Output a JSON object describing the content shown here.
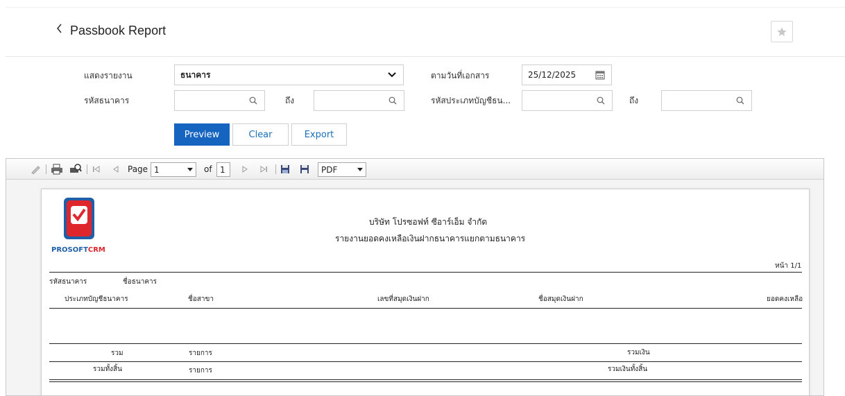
{
  "header": {
    "title": "Passbook Report",
    "back_icon": "chevron-left-icon",
    "favorite_icon": "star-icon"
  },
  "form": {
    "report_by_label": "แสดงรายงาน",
    "report_by_value": "ธนาคาร",
    "doc_date_label": "ตามวันที่เอกสาร",
    "doc_date_value": "25/12/2025",
    "bank_code_label": "รหัสธนาคาร",
    "bank_code_from": "",
    "to_label": "ถึง",
    "bank_code_to": "",
    "account_type_label": "รหัสประเภทบัญชีธน...",
    "account_type_from": "",
    "account_type_to": ""
  },
  "buttons": {
    "preview": "Preview",
    "clear": "Clear",
    "export": "Export"
  },
  "toolbar": {
    "page_label": "Page",
    "page_value": "1",
    "of_label": "of",
    "total_pages": "1",
    "format_value": "PDF"
  },
  "report": {
    "logo_text_1": "PROSOFT",
    "logo_text_2": "CRM",
    "company_name": "บริษัท โปรซอฟท์ ซีอาร์เอ็ม จำกัด",
    "report_title": "รายงานยอดคงเหลือเงินฝากธนาคารแยกตามธนาคาร",
    "page_indicator": "หน้า 1/1",
    "col_bank_code": "รหัสธนาคาร",
    "col_bank_name": "ชื่อธนาคาร",
    "col_account_type": "ประเภทบัญชีธนาคาร",
    "col_branch": "ชื่อสาขา",
    "col_passbook_no": "เลขที่สมุดเงินฝาก",
    "col_passbook_name": "ชื่อสมุดเงินฝาก",
    "col_balance": "ยอดคงเหลือ",
    "total_label": "รวม",
    "items_label": "รายการ",
    "total_amount_label": "รวมเงิน",
    "grand_total_label": "รวมทั้งสิ้น",
    "grand_items_label": "รายการ",
    "grand_amount_label": "รวมเงินทั้งสิ้น"
  },
  "colors": {
    "primary": "#1565c0",
    "link": "#1a6fb8",
    "logo_red": "#e0262d",
    "logo_blue": "#1f5fa8"
  }
}
